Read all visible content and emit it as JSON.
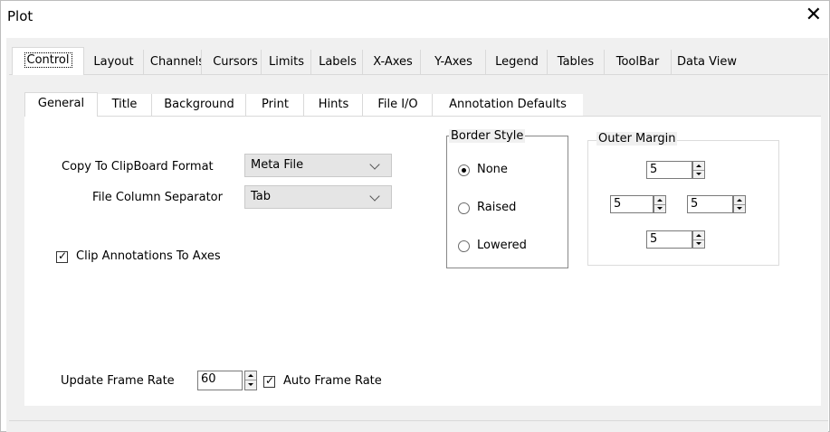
{
  "window": {
    "title": "Plot",
    "close_glyph": "✕"
  },
  "outer_tabs": [
    "Control",
    "Layout",
    "Channels",
    "Cursors",
    "Limits",
    "Labels",
    "X-Axes",
    "Y-Axes",
    "Legend",
    "Tables",
    "ToolBar",
    "Data View"
  ],
  "inner_tabs": [
    "General",
    "Title",
    "Background",
    "Print",
    "Hints",
    "File I/O",
    "Annotation Defaults"
  ],
  "general": {
    "clipboard_label": "Copy To ClipBoard Format",
    "clipboard_value": "Meta File",
    "separator_label": "File Column Separator",
    "separator_value": "Tab",
    "clip_label": "Clip Annotations To Axes",
    "clip_checked": true,
    "update_label": "Update Frame Rate",
    "update_value": "60",
    "auto_label": "Auto Frame Rate",
    "auto_checked": true
  },
  "border_style": {
    "title": "Border Style",
    "options": [
      "None",
      "Raised",
      "Lowered"
    ],
    "selected": "None"
  },
  "outer_margin": {
    "title": "Outer Margin",
    "top": "5",
    "left": "5",
    "right": "5",
    "bottom": "5"
  }
}
